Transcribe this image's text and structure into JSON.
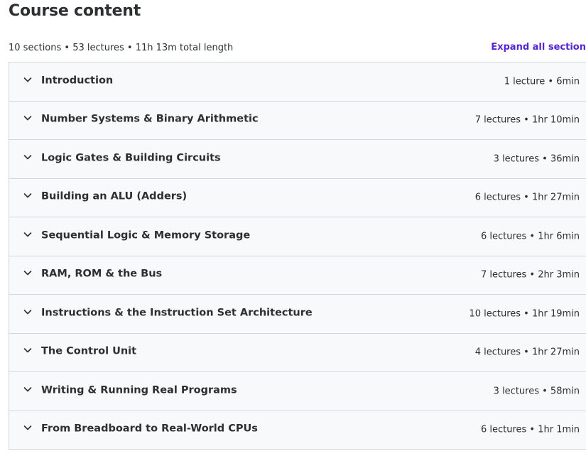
{
  "header": {
    "title": "Course content",
    "summary": "10 sections • 53 lectures • 11h 13m total length",
    "expand_all_label": "Expand all section"
  },
  "colors": {
    "accent": "#5624d0",
    "text": "#2d2f31",
    "section_bg": "#f7f9fa",
    "border": "#d1d7dc"
  },
  "sections": [
    {
      "title": "Introduction",
      "meta": "1 lecture • 6min",
      "icon": "chevron-down-icon"
    },
    {
      "title": "Number Systems & Binary Arithmetic",
      "meta": "7 lectures • 1hr 10min",
      "icon": "chevron-down-icon"
    },
    {
      "title": "Logic Gates & Building Circuits",
      "meta": "3 lectures • 36min",
      "icon": "chevron-down-icon"
    },
    {
      "title": "Building an ALU (Adders)",
      "meta": "6 lectures • 1hr 27min",
      "icon": "chevron-down-icon"
    },
    {
      "title": "Sequential Logic & Memory Storage",
      "meta": "6 lectures • 1hr 6min",
      "icon": "chevron-down-icon"
    },
    {
      "title": "RAM, ROM & the Bus",
      "meta": "7 lectures • 2hr 3min",
      "icon": "chevron-down-icon"
    },
    {
      "title": "Instructions & the Instruction Set Architecture",
      "meta": "10 lectures • 1hr 19min",
      "icon": "chevron-down-icon"
    },
    {
      "title": "The Control Unit",
      "meta": "4 lectures • 1hr 27min",
      "icon": "chevron-down-icon"
    },
    {
      "title": "Writing & Running Real Programs",
      "meta": "3 lectures • 58min",
      "icon": "chevron-down-icon"
    },
    {
      "title": "From Breadboard to Real-World CPUs",
      "meta": "6 lectures • 1hr 1min",
      "icon": "chevron-down-icon"
    }
  ]
}
